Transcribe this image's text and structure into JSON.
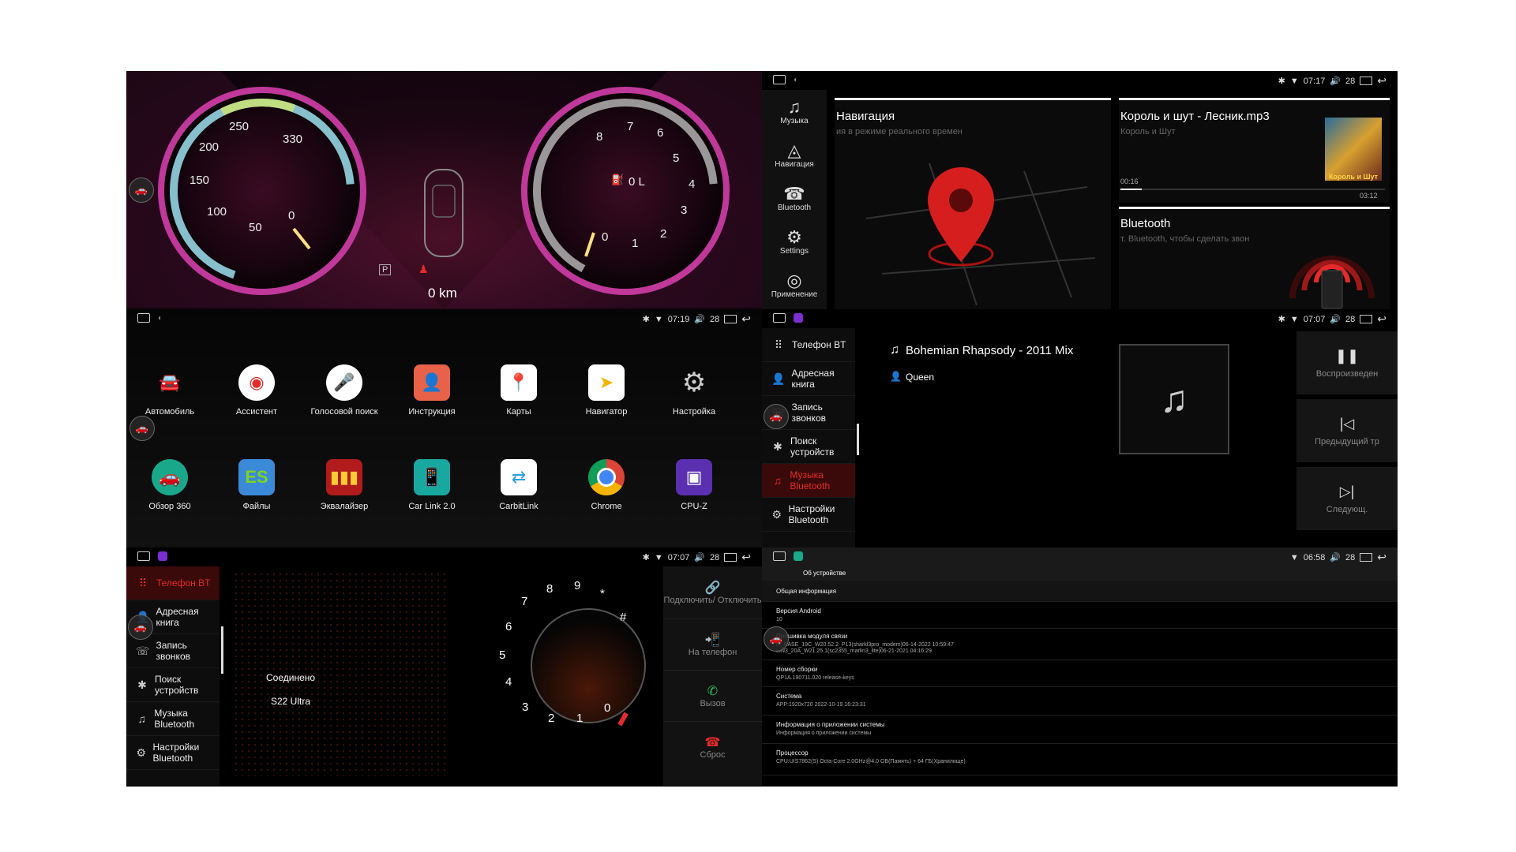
{
  "dashboard": {
    "speed_ticks": [
      "250",
      "330",
      "200",
      "150",
      "100",
      "50",
      "0"
    ],
    "rpm_ticks": [
      "8",
      "7",
      "6",
      "5",
      "4",
      "3",
      "2",
      "1",
      "0"
    ],
    "fuel": "0 L",
    "gear": "P",
    "odometer": "0 km"
  },
  "nav_panel": {
    "sidebar": [
      "Музыка",
      "Навигация",
      "Bluetooth",
      "Settings",
      "Применение"
    ],
    "status_time": "07:17",
    "status_vol": "28",
    "nav_card_title": "Навигация",
    "nav_card_sub": "ия в режиме реального времен",
    "music_card_title": "Король и шут - Лесник.mp3",
    "music_card_artist": "Король и Шут",
    "music_elapsed": "00:16",
    "music_total": "03:12",
    "bt_card_title": "Bluetooth",
    "bt_card_sub": "т. Bluetooth, чтобы сделать звон",
    "album_logo": "Король и Шут"
  },
  "apps_panel": {
    "status_time": "07:19",
    "status_vol": "28",
    "row1": [
      "Автомобиль",
      "Ассистент",
      "Голосовой поиск",
      "Инструкция",
      "Карты",
      "Навигатор",
      "Настройка"
    ],
    "row2": [
      "Обзор 360",
      "Файлы",
      "Эквалайзер",
      "Car Link 2.0",
      "CarbitLink",
      "Chrome",
      "CPU-Z"
    ]
  },
  "bt_music_panel": {
    "status_time": "07:07",
    "status_vol": "28",
    "menu": [
      "Телефон BT",
      "Адресная книга",
      "Запись звонков",
      "Поиск устройств",
      "Музыка Bluetooth",
      "Настройки Bluetooth"
    ],
    "track": "Bohemian Rhapsody - 2011 Mix",
    "artist": "Queen",
    "controls": [
      "Воспроизведен",
      "Предыдущий тр",
      "Следующ."
    ]
  },
  "bt_phone_panel": {
    "status_time": "07:07",
    "status_vol": "28",
    "menu": [
      "Телефон BT",
      "Адресная книга",
      "Запись звонков",
      "Поиск устройств",
      "Музыка Bluetooth",
      "Настройки Bluetooth"
    ],
    "connected": "Соединено",
    "device": "S22 Ultra",
    "dial": [
      "8",
      "9",
      "*",
      "7",
      "#",
      "6",
      "5",
      "4",
      "3",
      "2",
      "1",
      "0"
    ],
    "actions": [
      "Подключить/ Отключить",
      "На телефон",
      "Вызов",
      "Сброс"
    ]
  },
  "about_panel": {
    "status_time": "06:58",
    "status_vol": "28",
    "header": "Об устройстве",
    "rows": [
      {
        "t": "Общая информация",
        "v": ""
      },
      {
        "t": "Версия Android",
        "v": "10"
      },
      {
        "t": "Прошивка модуля связи",
        "v": "M_BASE_19C_W20.52.2_P13(sharkl3pro_modem)06-14-2022 10:59:47",
        "v2": "LIN3_20A_W21.25.1(sc2355_marlin3_lite)06-21-2021 04:16:29"
      },
      {
        "t": "Номер сборки",
        "v": "QP1A.190711.020 release-keys"
      },
      {
        "t": "Система",
        "v": "APP:1920x720 2022-10-19 16:23:31"
      },
      {
        "t": "Информация о приложении системы",
        "v": "Информация о приложении системы"
      },
      {
        "t": "Процессор",
        "v": "CPU:UIS7862(S) Octa-Core 2.0GHz@4.0 GB(Память) + 64 ГБ(Хранилище)"
      }
    ]
  },
  "colors": {
    "accent_red": "#e52a2a",
    "gauge_pink": "#d63ca0",
    "bg": "#000000"
  }
}
